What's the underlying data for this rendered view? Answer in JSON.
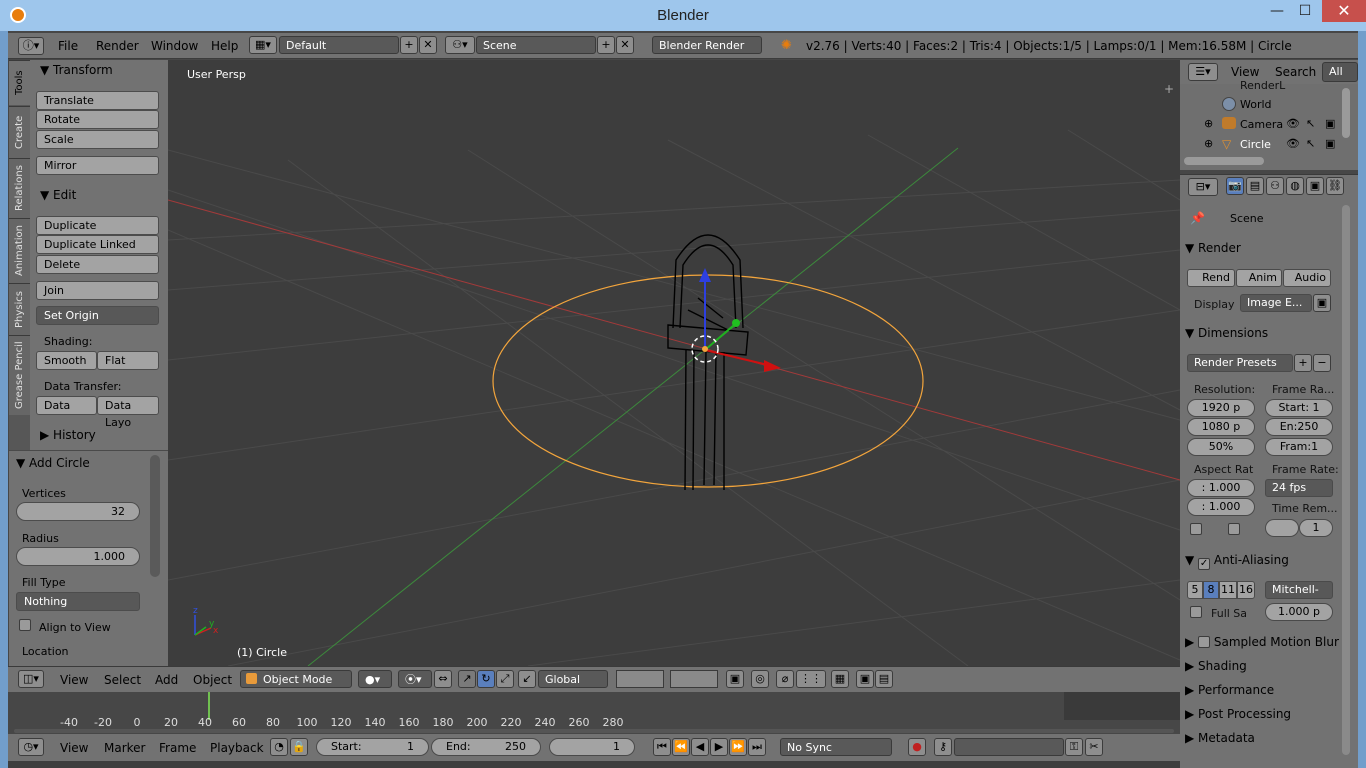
{
  "window": {
    "title": "Blender",
    "minimize": "—",
    "maximize": "☐",
    "close": "✕"
  },
  "info_header": {
    "menus": [
      "File",
      "Render",
      "Window",
      "Help"
    ],
    "layout": "Default",
    "scene": "Scene",
    "engine": "Blender Render",
    "stats": "v2.76 | Verts:40 | Faces:2 | Tris:4 | Objects:1/5 | Lamps:0/1 | Mem:16.58M | Circle"
  },
  "tabs": [
    "Tools",
    "Create",
    "Relations",
    "Animation",
    "Physics",
    "Grease Pencil"
  ],
  "toolshelf": {
    "transform": {
      "title": "Transform",
      "buttons": [
        "Translate",
        "Rotate",
        "Scale",
        "Mirror"
      ]
    },
    "edit": {
      "title": "Edit",
      "buttons": [
        "Duplicate",
        "Duplicate Linked",
        "Delete",
        "Join"
      ],
      "set_origin": "Set Origin"
    },
    "shading": {
      "label": "Shading:",
      "smooth": "Smooth",
      "flat": "Flat"
    },
    "data_transfer": {
      "label": "Data Transfer:",
      "data": "Data",
      "data_layout": "Data Layo"
    },
    "history": "History"
  },
  "add_circle": {
    "title": "Add Circle",
    "vertices_label": "Vertices",
    "vertices": "32",
    "radius_label": "Radius",
    "radius": "1.000",
    "fill_label": "Fill Type",
    "fill": "Nothing",
    "align": "Align to View",
    "location": "Location"
  },
  "viewport": {
    "view_label": "User Persp",
    "object_label": "(1) Circle"
  },
  "view_header": {
    "menus": [
      "View",
      "Select",
      "Add",
      "Object"
    ],
    "mode": "Object Mode",
    "orientation": "Global"
  },
  "timeline": {
    "ticks": [
      "-40",
      "-20",
      "0",
      "20",
      "40",
      "60",
      "80",
      "100",
      "120",
      "140",
      "160",
      "180",
      "200",
      "220",
      "240",
      "260",
      "280"
    ]
  },
  "timeline_header": {
    "menus": [
      "View",
      "Marker",
      "Frame",
      "Playback"
    ],
    "start_label": "Start:",
    "start": "1",
    "end_label": "End:",
    "end": "250",
    "current": "1",
    "sync": "No Sync"
  },
  "outliner": {
    "menus": [
      "View",
      "Search"
    ],
    "filter": "All Sc",
    "items": [
      "RenderL",
      "World",
      "Camera",
      "Circle"
    ]
  },
  "properties": {
    "scene": "Scene",
    "render": {
      "title": "Render",
      "rend": "Rend",
      "anim": "Anim",
      "audio": "Audio",
      "display_label": "Display",
      "display": "Image E..."
    },
    "dimensions": {
      "title": "Dimensions",
      "presets": "Render Presets",
      "resolution_label": "Resolution:",
      "res_x": "1920 p",
      "res_y": "1080 p",
      "res_pct": "50%",
      "frame_range_label": "Frame Ra...",
      "start": "Start: 1",
      "end": "En:250",
      "step": "Fram:1",
      "aspect_label": "Aspect Rat",
      "aspect_x": ": 1.000",
      "aspect_y": ": 1.000",
      "frame_rate_label": "Frame Rate:",
      "fps": "24 fps",
      "time_remap_label": "Time Rem...",
      "time_remap": "1"
    },
    "anti_aliasing": {
      "title": "Anti-Aliasing",
      "samples": [
        "5",
        "8",
        "11",
        "16"
      ],
      "filter": "Mitchell-",
      "full_sample": "Full Sa",
      "size": "1.000 p"
    },
    "collapsed": [
      "Sampled Motion Blur",
      "Shading",
      "Performance",
      "Post Processing",
      "Metadata"
    ]
  }
}
